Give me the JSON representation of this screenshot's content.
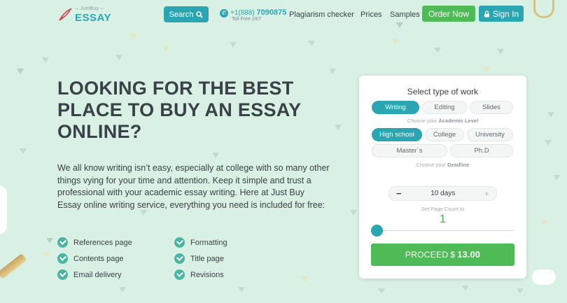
{
  "header": {
    "logo_small": "– JustBuy –",
    "logo_big": "ESSAY",
    "search_label": "Search",
    "phone_prefix": "+1(888)",
    "phone_number": "7090875",
    "phone_note": "Toll Free 24/7",
    "nav": [
      "Plagiarism checker",
      "Prices",
      "Samples"
    ],
    "order_label": "Order Now",
    "signin_label": "Sign In"
  },
  "hero": {
    "title": "LOOKING FOR THE BEST PLACE TO BUY AN ESSAY ONLINE?",
    "text": "We all know writing isn’t easy, especially at college with so many other things vying for your time and attention. Keep it simple and trust a professional with your academic essay writing. Here at Just Buy Essay online writing service, everything you need is included for free:",
    "features_left": [
      "References page",
      "Contents page",
      "Email delivery"
    ],
    "features_right": [
      "Formatting",
      "Title page",
      "Revisions"
    ]
  },
  "order_form": {
    "title": "Select type of work",
    "work_types": [
      "Writing",
      "Editing",
      "Slides"
    ],
    "selected_work_type": "Writing",
    "academic_hint_prefix": "Choose your",
    "academic_hint_bold": "Academic Level",
    "levels": [
      "High school",
      "College",
      "University",
      "Master`s",
      "Ph.D"
    ],
    "selected_level": "High school",
    "deadline_hint_prefix": "Choose your",
    "deadline_hint_bold": "Deadline",
    "deadline_value": "10 days",
    "minus": "−",
    "plus": "+",
    "pages_label": "Set Page Count to",
    "pages_value": "1",
    "slider_fraction": 0.0,
    "proceed_label": "PROCEED",
    "price": "13.00",
    "currency": "$"
  },
  "colors": {
    "background": "#d9f0e4",
    "teal": "#2aa6b3",
    "green": "#4fbb57",
    "check": "#4bb5a1"
  },
  "icons": [
    "quill-icon",
    "search-icon",
    "phone-icon",
    "lock-icon",
    "check-icon"
  ]
}
